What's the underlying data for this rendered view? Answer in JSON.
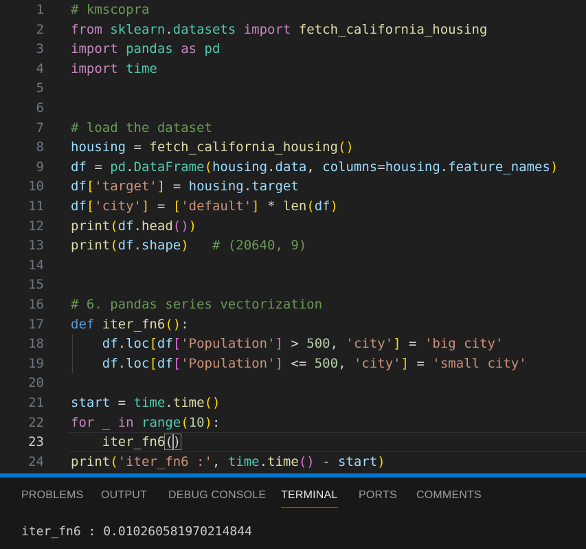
{
  "editor": {
    "active_line": 23,
    "line_numbers": [
      "1",
      "2",
      "3",
      "4",
      "5",
      "6",
      "7",
      "8",
      "9",
      "10",
      "11",
      "12",
      "13",
      "14",
      "15",
      "16",
      "17",
      "18",
      "19",
      "20",
      "21",
      "22",
      "23",
      "24"
    ],
    "lines": [
      [
        [
          "cm",
          "# kmscopra"
        ]
      ],
      [
        [
          "kw",
          "from"
        ],
        [
          "op",
          " "
        ],
        [
          "cl",
          "sklearn"
        ],
        [
          "op",
          "."
        ],
        [
          "cl",
          "datasets"
        ],
        [
          "op",
          " "
        ],
        [
          "kw",
          "import"
        ],
        [
          "op",
          " "
        ],
        [
          "fn",
          "fetch_california_housing"
        ]
      ],
      [
        [
          "kw",
          "import"
        ],
        [
          "op",
          " "
        ],
        [
          "cl",
          "pandas"
        ],
        [
          "op",
          " "
        ],
        [
          "kw",
          "as"
        ],
        [
          "op",
          " "
        ],
        [
          "cl",
          "pd"
        ]
      ],
      [
        [
          "kw",
          "import"
        ],
        [
          "op",
          " "
        ],
        [
          "cl",
          "time"
        ]
      ],
      [],
      [],
      [
        [
          "cm",
          "# load the dataset"
        ]
      ],
      [
        [
          "va",
          "housing"
        ],
        [
          "op",
          " = "
        ],
        [
          "fn",
          "fetch_california_housing"
        ],
        [
          "b1",
          "()"
        ]
      ],
      [
        [
          "va",
          "df"
        ],
        [
          "op",
          " = "
        ],
        [
          "cl",
          "pd"
        ],
        [
          "op",
          "."
        ],
        [
          "cl",
          "DataFrame"
        ],
        [
          "b1",
          "("
        ],
        [
          "va",
          "housing"
        ],
        [
          "op",
          "."
        ],
        [
          "va",
          "data"
        ],
        [
          "op",
          ", "
        ],
        [
          "va",
          "columns"
        ],
        [
          "op",
          "="
        ],
        [
          "va",
          "housing"
        ],
        [
          "op",
          "."
        ],
        [
          "va",
          "feature_names"
        ],
        [
          "b1",
          ")"
        ]
      ],
      [
        [
          "va",
          "df"
        ],
        [
          "b1",
          "["
        ],
        [
          "st",
          "'target'"
        ],
        [
          "b1",
          "]"
        ],
        [
          "op",
          " = "
        ],
        [
          "va",
          "housing"
        ],
        [
          "op",
          "."
        ],
        [
          "va",
          "target"
        ]
      ],
      [
        [
          "va",
          "df"
        ],
        [
          "b1",
          "["
        ],
        [
          "st",
          "'city'"
        ],
        [
          "b1",
          "]"
        ],
        [
          "op",
          " = "
        ],
        [
          "b1",
          "["
        ],
        [
          "st",
          "'default'"
        ],
        [
          "b1",
          "]"
        ],
        [
          "op",
          " * "
        ],
        [
          "fn",
          "len"
        ],
        [
          "b1",
          "("
        ],
        [
          "va",
          "df"
        ],
        [
          "b1",
          ")"
        ]
      ],
      [
        [
          "fn",
          "print"
        ],
        [
          "b1",
          "("
        ],
        [
          "va",
          "df"
        ],
        [
          "op",
          "."
        ],
        [
          "fn",
          "head"
        ],
        [
          "b2",
          "()"
        ],
        [
          "b1",
          ")"
        ]
      ],
      [
        [
          "fn",
          "print"
        ],
        [
          "b1",
          "("
        ],
        [
          "va",
          "df"
        ],
        [
          "op",
          "."
        ],
        [
          "va",
          "shape"
        ],
        [
          "b1",
          ")"
        ],
        [
          "op",
          "   "
        ],
        [
          "cm",
          "# (20640, 9)"
        ]
      ],
      [],
      [],
      [
        [
          "cm",
          "# 6. pandas series vectorization"
        ]
      ],
      [
        [
          "df",
          "def"
        ],
        [
          "op",
          " "
        ],
        [
          "fn",
          "iter_fn6"
        ],
        [
          "b1",
          "()"
        ],
        [
          "op",
          ":"
        ]
      ],
      [
        [
          "op",
          "    "
        ],
        [
          "va",
          "df"
        ],
        [
          "op",
          "."
        ],
        [
          "va",
          "loc"
        ],
        [
          "b1",
          "["
        ],
        [
          "va",
          "df"
        ],
        [
          "b2",
          "["
        ],
        [
          "st",
          "'Population'"
        ],
        [
          "b2",
          "]"
        ],
        [
          "op",
          " > "
        ],
        [
          "nu",
          "500"
        ],
        [
          "op",
          ", "
        ],
        [
          "st",
          "'city'"
        ],
        [
          "b1",
          "]"
        ],
        [
          "op",
          " = "
        ],
        [
          "st",
          "'big city'"
        ]
      ],
      [
        [
          "op",
          "    "
        ],
        [
          "va",
          "df"
        ],
        [
          "op",
          "."
        ],
        [
          "va",
          "loc"
        ],
        [
          "b1",
          "["
        ],
        [
          "va",
          "df"
        ],
        [
          "b2",
          "["
        ],
        [
          "st",
          "'Population'"
        ],
        [
          "b2",
          "]"
        ],
        [
          "op",
          " <= "
        ],
        [
          "nu",
          "500"
        ],
        [
          "op",
          ", "
        ],
        [
          "st",
          "'city'"
        ],
        [
          "b1",
          "]"
        ],
        [
          "op",
          " = "
        ],
        [
          "st",
          "'small city'"
        ]
      ],
      [],
      [
        [
          "va",
          "start"
        ],
        [
          "op",
          " = "
        ],
        [
          "cl",
          "time"
        ],
        [
          "op",
          "."
        ],
        [
          "fn",
          "time"
        ],
        [
          "b1",
          "()"
        ]
      ],
      [
        [
          "kw",
          "for"
        ],
        [
          "op",
          " "
        ],
        [
          "va",
          "_"
        ],
        [
          "op",
          " "
        ],
        [
          "kw",
          "in"
        ],
        [
          "op",
          " "
        ],
        [
          "cl",
          "range"
        ],
        [
          "b1",
          "("
        ],
        [
          "nu",
          "10"
        ],
        [
          "b1",
          ")"
        ],
        [
          "op",
          ":"
        ]
      ],
      [
        [
          "op",
          "    "
        ],
        [
          "fn",
          "iter_fn6"
        ],
        [
          "bm",
          "()"
        ]
      ],
      [
        [
          "fn",
          "print"
        ],
        [
          "b1",
          "("
        ],
        [
          "st",
          "'iter_fn6 :'"
        ],
        [
          "op",
          ", "
        ],
        [
          "cl",
          "time"
        ],
        [
          "op",
          "."
        ],
        [
          "fn",
          "time"
        ],
        [
          "b2",
          "()"
        ],
        [
          "op",
          " - "
        ],
        [
          "va",
          "start"
        ],
        [
          "b1",
          ")"
        ]
      ]
    ]
  },
  "panel": {
    "tabs": [
      {
        "label": "PROBLEMS"
      },
      {
        "label": "OUTPUT"
      },
      {
        "label": "DEBUG CONSOLE"
      },
      {
        "label": "TERMINAL"
      },
      {
        "label": "PORTS"
      },
      {
        "label": "COMMENTS"
      }
    ],
    "active_tab": "TERMINAL",
    "terminal_output": "iter_fn6 : 0.010260581970214844"
  },
  "colors": {
    "editor_bg": "#1f1f1f",
    "panel_bg": "#181818",
    "accent": "#0078d4"
  }
}
